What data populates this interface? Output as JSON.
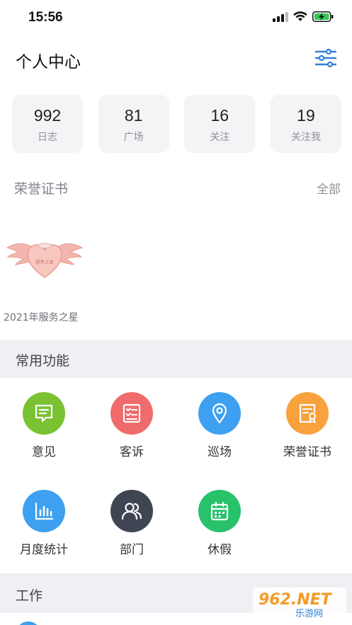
{
  "status_bar": {
    "time": "15:56"
  },
  "header": {
    "title": "个人中心"
  },
  "stats": [
    {
      "value": "992",
      "label": "日志"
    },
    {
      "value": "81",
      "label": "广场"
    },
    {
      "value": "16",
      "label": "关注"
    },
    {
      "value": "19",
      "label": "关注我"
    }
  ],
  "honor": {
    "title": "荣誉证书",
    "all_label": "全部",
    "badge_caption": "2021年服务之星",
    "badge_text": "服务之星"
  },
  "common_functions": {
    "title": "常用功能",
    "items": [
      {
        "label": "意见",
        "icon": "message-icon",
        "color": "#7ac231"
      },
      {
        "label": "客诉",
        "icon": "checklist-icon",
        "color": "#f06b6b"
      },
      {
        "label": "巡场",
        "icon": "location-pin-icon",
        "color": "#3da0f0"
      },
      {
        "label": "荣誉证书",
        "icon": "certificate-icon",
        "color": "#f7a23c"
      },
      {
        "label": "月度统计",
        "icon": "bar-chart-icon",
        "color": "#3da0f0"
      },
      {
        "label": "部门",
        "icon": "users-icon",
        "color": "#3f4552"
      },
      {
        "label": "休假",
        "icon": "calendar-icon",
        "color": "#27c26a"
      }
    ]
  },
  "work": {
    "title": "工作"
  },
  "watermark": {
    "main": "962.NET",
    "sub": "乐游网"
  }
}
